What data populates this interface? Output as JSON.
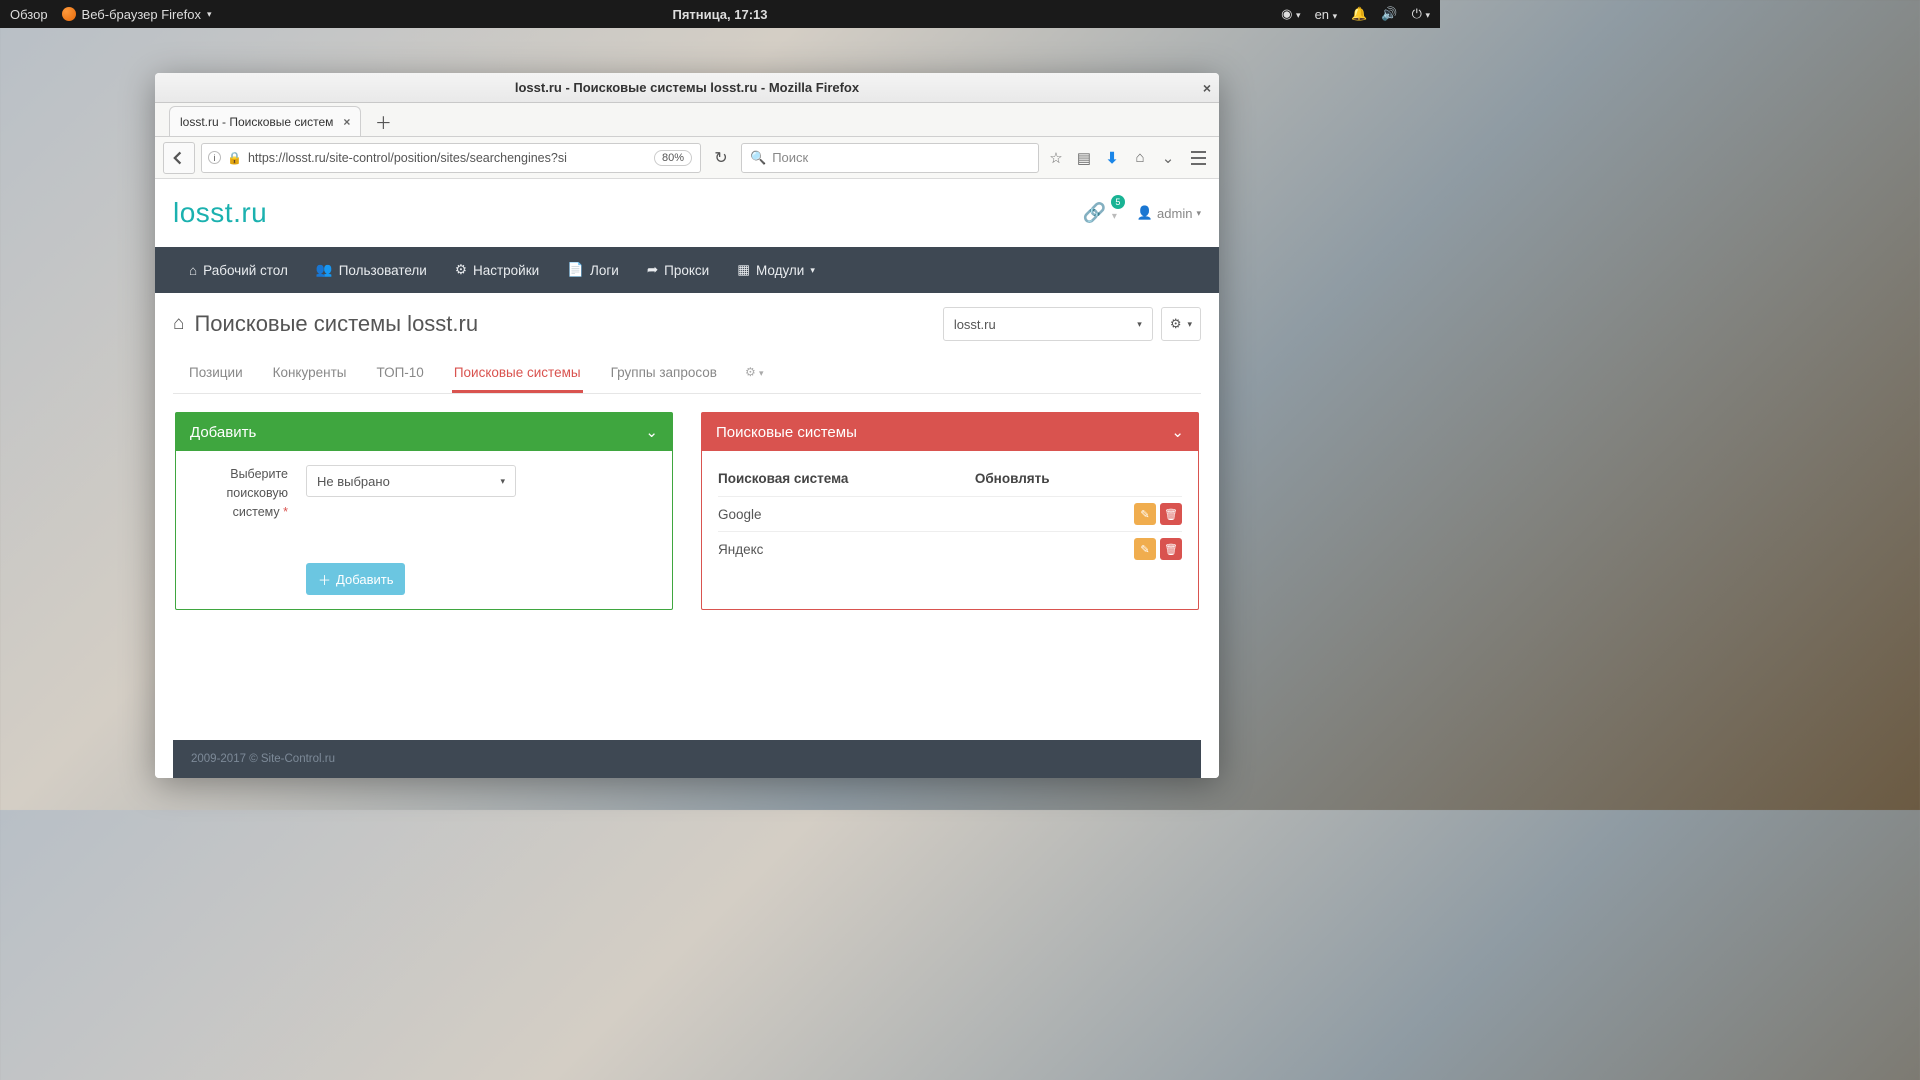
{
  "gnome": {
    "activities": "Обзор",
    "app": "Веб-браузер Firefox",
    "clock": "Пятница, 17:13",
    "lang": "en"
  },
  "firefox": {
    "title": "losst.ru - Поисковые системы losst.ru - Mozilla Firefox",
    "tab_label": "losst.ru - Поисковые систем",
    "url": "https://losst.ru/site-control/position/sites/searchengines?si",
    "zoom": "80%",
    "search_placeholder": "Поиск"
  },
  "app": {
    "brand": "losst.ru",
    "cart_badge": "5",
    "user": "admin",
    "nav": {
      "dashboard": "Рабочий стол",
      "users": "Пользователи",
      "settings": "Настройки",
      "logs": "Логи",
      "proxy": "Прокси",
      "modules": "Модули"
    },
    "page_title": "Поисковые системы losst.ru",
    "site_select": "losst.ru",
    "tabs": {
      "positions": "Позиции",
      "competitors": "Конкуренты",
      "top10": "ТОП-10",
      "engines": "Поисковые системы",
      "groups": "Группы запросов"
    },
    "add_card": {
      "title": "Добавить",
      "label": "Выберите поисковую систему",
      "select": "Не выбрано",
      "button": "Добавить"
    },
    "list_card": {
      "title": "Поисковые системы",
      "col_engine": "Поисковая система",
      "col_update": "Обновлять",
      "rows": [
        {
          "name": "Google"
        },
        {
          "name": "Яндекс"
        }
      ]
    },
    "footer": "2009-2017 © Site-Control.ru"
  }
}
